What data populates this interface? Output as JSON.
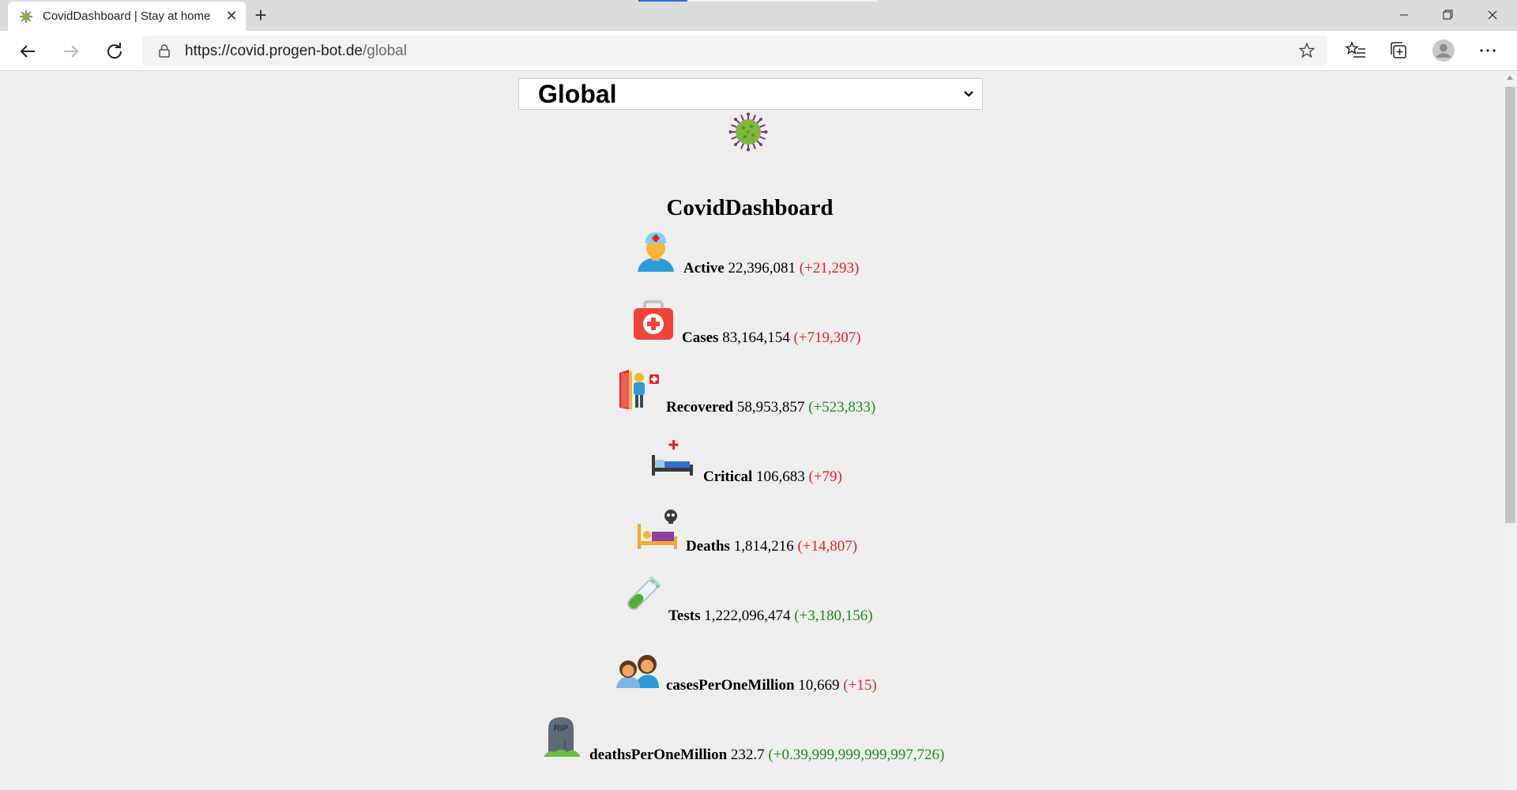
{
  "browser": {
    "tab_title": "CovidDashboard | Stay at home",
    "url_host": "https://covid.progen-bot.de",
    "url_path": "/global"
  },
  "page": {
    "region_select": "Global",
    "title": "CovidDashboard"
  },
  "stats": [
    {
      "label": "Active",
      "value": "22,396,081",
      "delta": "(+21,293)",
      "delta_color": "red",
      "icon": "doctor-icon"
    },
    {
      "label": "Cases",
      "value": "83,164,154",
      "delta": "(+719,307)",
      "delta_color": "red",
      "icon": "first-aid-kit-icon"
    },
    {
      "label": "Recovered",
      "value": "58,953,857",
      "delta": "(+523,833)",
      "delta_color": "green",
      "icon": "patient-discharge-icon"
    },
    {
      "label": "Critical",
      "value": "106,683",
      "delta": "(+79)",
      "delta_color": "red",
      "icon": "hospital-bed-icon"
    },
    {
      "label": "Deaths",
      "value": "1,814,216",
      "delta": "(+14,807)",
      "delta_color": "red",
      "icon": "deathbed-icon"
    },
    {
      "label": "Tests",
      "value": "1,222,096,474",
      "delta": "(+3,180,156)",
      "delta_color": "green",
      "icon": "test-tube-icon"
    },
    {
      "label": "casesPerOneMillion",
      "value": "10,669",
      "delta": "(+15)",
      "delta_color": "red",
      "icon": "people-icon"
    },
    {
      "label": "deathsPerOneMillion",
      "value": "232.7",
      "delta": "(+0.39,999,999,999,997,726)",
      "delta_color": "green",
      "icon": "gravestone-icon",
      "icon_text": "RIP"
    }
  ],
  "colors": {
    "delta_red": "#e8211c",
    "delta_green": "#1b8c1b",
    "page_bg": "#eeeeee"
  }
}
